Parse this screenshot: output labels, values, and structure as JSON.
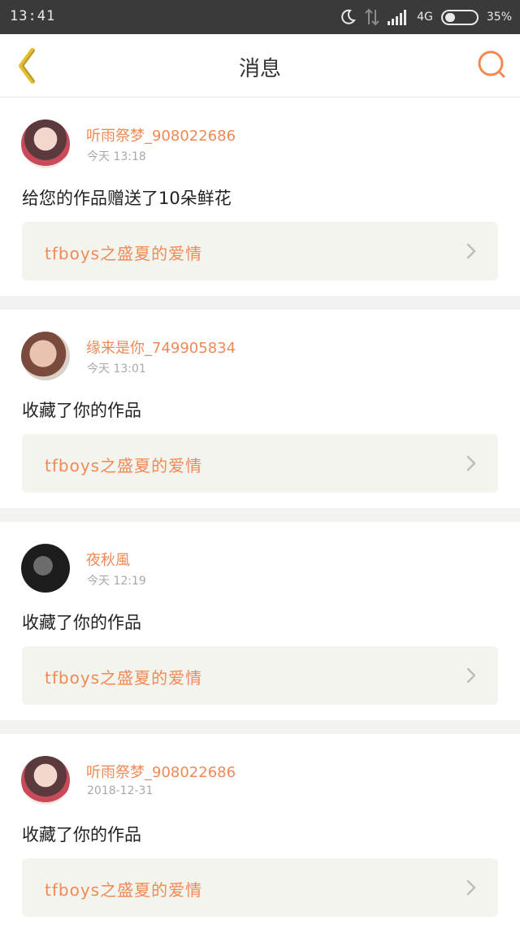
{
  "status_bar": {
    "time": "13:41",
    "network": "4G",
    "battery": "35%"
  },
  "header": {
    "title": "消息"
  },
  "messages": [
    {
      "username": "听雨祭梦_908022686",
      "time": "今天 13:18",
      "text": "给您的作品赠送了10朵鲜花",
      "work_title": "tfboys之盛夏的爱情"
    },
    {
      "username": "缘来是你_749905834",
      "time": "今天 13:01",
      "text": "收藏了你的作品",
      "work_title": "tfboys之盛夏的爱情"
    },
    {
      "username": "夜秋風",
      "time": "今天 12:19",
      "text": "收藏了你的作品",
      "work_title": "tfboys之盛夏的爱情"
    },
    {
      "username": "听雨祭梦_908022686",
      "time": "2018-12-31",
      "text": "收藏了你的作品",
      "work_title": "tfboys之盛夏的爱情"
    }
  ],
  "colors": {
    "accent": "#f08a55",
    "back_icon": "#e6bf2e",
    "status_bar_bg": "#3a3a3a"
  },
  "icons": {
    "back": "back-chevron-icon",
    "search": "search-icon",
    "moon": "moon-icon",
    "signal": "signal-icon",
    "data": "data-transfer-icon",
    "battery": "battery-icon",
    "chevron": "chevron-right-icon"
  }
}
